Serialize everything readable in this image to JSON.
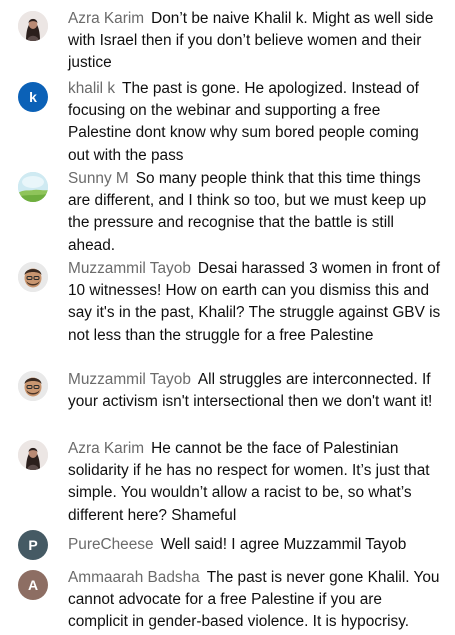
{
  "messages": [
    {
      "author": "Azra Karim",
      "avatar": {
        "kind": "photo",
        "icon": "woman-photo-avatar",
        "bg": "#e9e3e1"
      },
      "text": "Don’t be naive Khalil k. Might as well side with Israel then if you don’t believe women and their justice"
    },
    {
      "author": "khalil k",
      "avatar": {
        "kind": "letter",
        "letter": "k",
        "bg": "#0b61b7"
      },
      "text": "The past is gone. He apologized. Instead of focusing on the webinar and supporting a free Palestine dont know why sum bored people coming out with the pass"
    },
    {
      "author": "Sunny M",
      "avatar": {
        "kind": "photo",
        "icon": "landscape-photo-avatar",
        "bg": "#bfe3ea"
      },
      "text": "So many people think that this time things are different, and I think so too, but we must keep up the pressure and recognise that the battle is still ahead."
    },
    {
      "author": "Muzzammil Tayob",
      "avatar": {
        "kind": "photo",
        "icon": "bitmoji-man-avatar",
        "bg": "#e8e8e8"
      },
      "text": "Desai harassed 3 women in front of 10 witnesses! How on earth can you dismiss this and say it's in the past, Khalil? The struggle against GBV is not less than the struggle for a free Palestine"
    },
    {
      "author": "Muzzammil Tayob",
      "avatar": {
        "kind": "photo",
        "icon": "bitmoji-man-avatar",
        "bg": "#e8e8e8"
      },
      "text": "All struggles are interconnected. If your activism isn't intersectional then we don't want it!"
    },
    {
      "author": "Azra Karim",
      "avatar": {
        "kind": "photo",
        "icon": "woman-photo-avatar",
        "bg": "#e9e3e1"
      },
      "text": "He cannot be the face of Palestinian solidarity if he has no respect for women. It’s just that simple. You wouldn’t allow a racist to be, so what’s different here? Shameful"
    },
    {
      "author": "PureCheese",
      "avatar": {
        "kind": "letter",
        "letter": "P",
        "bg": "#455a64"
      },
      "text": "Well said! I agree Muzzammil Tayob"
    },
    {
      "author": "Ammaarah Badsha",
      "avatar": {
        "kind": "letter",
        "letter": "A",
        "bg": "#8d6e63"
      },
      "text": "The past is never gone Khalil. You cannot advocate for a free Palestine if you are complicit in gender-based violence. It is hypocrisy."
    }
  ]
}
